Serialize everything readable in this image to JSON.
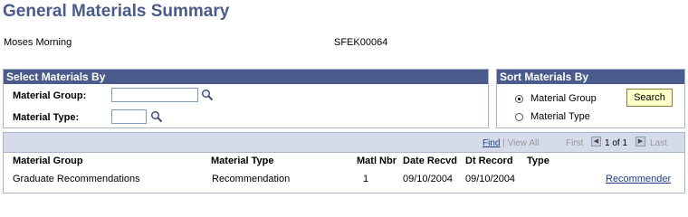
{
  "page": {
    "title": "General Materials Summary",
    "person_name": "Moses Morning",
    "person_id": "SFEK00064"
  },
  "select_materials": {
    "header": "Select Materials By",
    "material_group_label": "Material Group:",
    "material_group_value": "",
    "material_type_label": "Material Type:",
    "material_type_value": ""
  },
  "sort_materials": {
    "header": "Sort Materials By",
    "options": [
      {
        "label": "Material Group",
        "selected": true
      },
      {
        "label": "Material Type",
        "selected": false
      }
    ],
    "search_label": "Search"
  },
  "grid": {
    "nav": {
      "find": "Find",
      "separator": "|",
      "view_all": "View All",
      "first": "First",
      "range": "1 of 1",
      "last": "Last"
    },
    "columns": [
      "Material Group",
      "Material Type",
      "Matl Nbr",
      "Date Recvd",
      "Dt Record",
      "Type"
    ],
    "rows": [
      {
        "material_group": "Graduate Recommendations",
        "material_type": "Recommendation",
        "matl_nbr": "1",
        "date_recvd": "09/10/2004",
        "dt_record": "09/10/2004",
        "type": "",
        "link": "Recommender"
      }
    ]
  },
  "icons": {
    "lookup": "magnifier-icon",
    "prev": "left-arrow-icon",
    "next": "right-arrow-icon"
  },
  "colors": {
    "title": "#4a5b8c",
    "section_header": "#4a5b8c",
    "grid_bar": "#d5dbe8",
    "link": "#1f3e8a",
    "button": "#ffffc8"
  }
}
